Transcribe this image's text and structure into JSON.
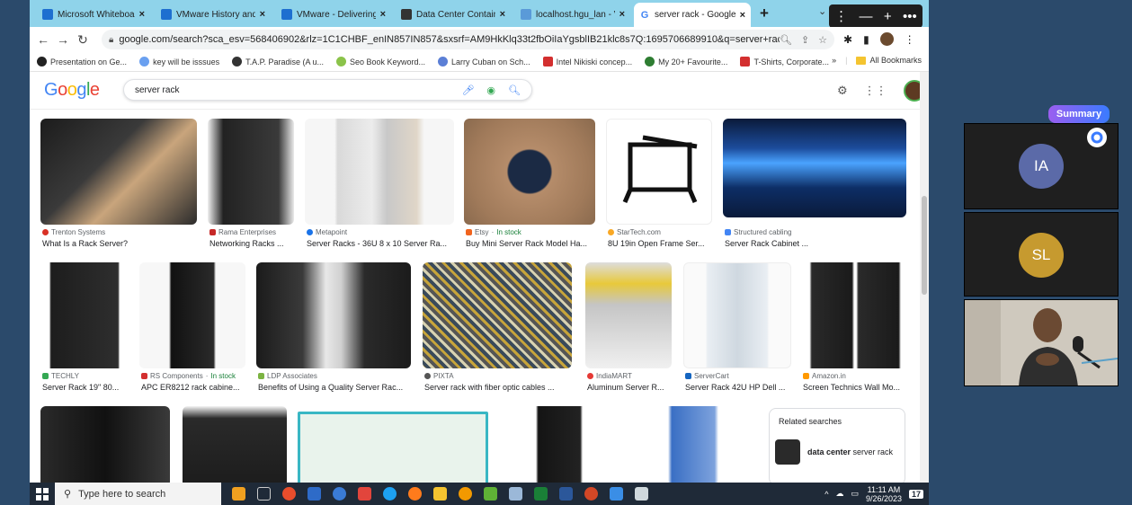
{
  "tabs": [
    {
      "label": "Microsoft Whiteboard",
      "color": "#1e6fd0"
    },
    {
      "label": "VMware History and i",
      "color": "#1e6fd0"
    },
    {
      "label": "VMware - Delivering a",
      "color": "#1e6fd0"
    },
    {
      "label": "Data Center Containm",
      "color": "#333333"
    },
    {
      "label": "localhost.hgu_lan - VI",
      "color": "#5a9ad8"
    },
    {
      "label": "server rack - Google S",
      "color": "#4285f4",
      "active": true
    }
  ],
  "window_controls": {
    "menu": "⋮",
    "minimize": "—",
    "add": "+",
    "more": "•••"
  },
  "toolbar": {
    "url": "google.com/search?sca_esv=568406902&rlz=1C1CHBF_enIN857IN857&sxsrf=AM9HkKlq33t2fbOiIaYgsblIB21klc8s7Q:1695706689910&q=server+rack&tbm=i..."
  },
  "bookmarks": [
    {
      "label": "Presentation on Ge...",
      "color": "#222222"
    },
    {
      "label": "key will be isssues",
      "color": "#6aa0f0"
    },
    {
      "label": "T.A.P. Paradise (A u...",
      "color": "#333333"
    },
    {
      "label": "Seo Book Keyword...",
      "color": "#8bc34a"
    },
    {
      "label": "Larry Cuban on Sch...",
      "color": "#5b7fd6"
    },
    {
      "label": "Intel Nikiski concep...",
      "color": "#d32f2f"
    },
    {
      "label": "My 20+ Favourite...",
      "color": "#2e7d32"
    },
    {
      "label": "T-Shirts, Corporate...",
      "color": "#d32f2f"
    }
  ],
  "bookmarks_more": "»",
  "all_bookmarks": "All Bookmarks",
  "google": {
    "logo": [
      "G",
      "o",
      "o",
      "g",
      "l",
      "e"
    ],
    "query": "server rack"
  },
  "results_row1": [
    {
      "source": "Trenton Systems",
      "title": "What Is a Rack Server?",
      "dot": "#d93025"
    },
    {
      "source": "Rama Enterprises",
      "title": "Networking Racks ...",
      "dot": "#c62828"
    },
    {
      "source": "Metapoint",
      "title": "Server Racks - 36U 8 x 10 Server Ra...",
      "dot": "#1a73e8"
    },
    {
      "source": "Etsy",
      "stock": "In stock",
      "title": "Buy Mini Server Rack Model Ha...",
      "dot": "#f1641e"
    },
    {
      "source": "StarTech.com",
      "title": "8U 19in Open Frame Ser...",
      "dot": "#f9a825"
    },
    {
      "source": "Structured cabling",
      "title": "Server Rack Cabinet ...",
      "dot": "#4285f4"
    }
  ],
  "results_row2": [
    {
      "source": "TECHLY",
      "title": "Server Rack 19\" 80...",
      "dot": "#34a853"
    },
    {
      "source": "RS Components",
      "stock": "In stock",
      "title": "APC ER8212 rack cabine...",
      "dot": "#d32f2f"
    },
    {
      "source": "LDP Associates",
      "title": "Benefits of Using a Quality Server Rac...",
      "dot": "#7cb342"
    },
    {
      "source": "PIXTA",
      "title": "Server rack with fiber optic cables ...",
      "dot": "#555555"
    },
    {
      "source": "IndiaMART",
      "title": "Aluminum Server R...",
      "dot": "#e53935"
    },
    {
      "source": "ServerCart",
      "title": "Server Rack 42U HP Dell ...",
      "dot": "#1565c0"
    },
    {
      "source": "Amazon.in",
      "title": "Screen Technics Wall Mo...",
      "dot": "#ff9900"
    }
  ],
  "related": {
    "heading": "Related searches",
    "item_bold": "data center",
    "item_rest": " server rack"
  },
  "taskbar": {
    "search_placeholder": "Type here to search",
    "time": "11:11 AM",
    "date": "9/26/2023",
    "notif": "17"
  },
  "teams": {
    "summary": "Summary",
    "participants": [
      {
        "initials": "IA",
        "color": "#5b6aa8"
      },
      {
        "initials": "SL",
        "color": "#c69a2f"
      }
    ]
  }
}
